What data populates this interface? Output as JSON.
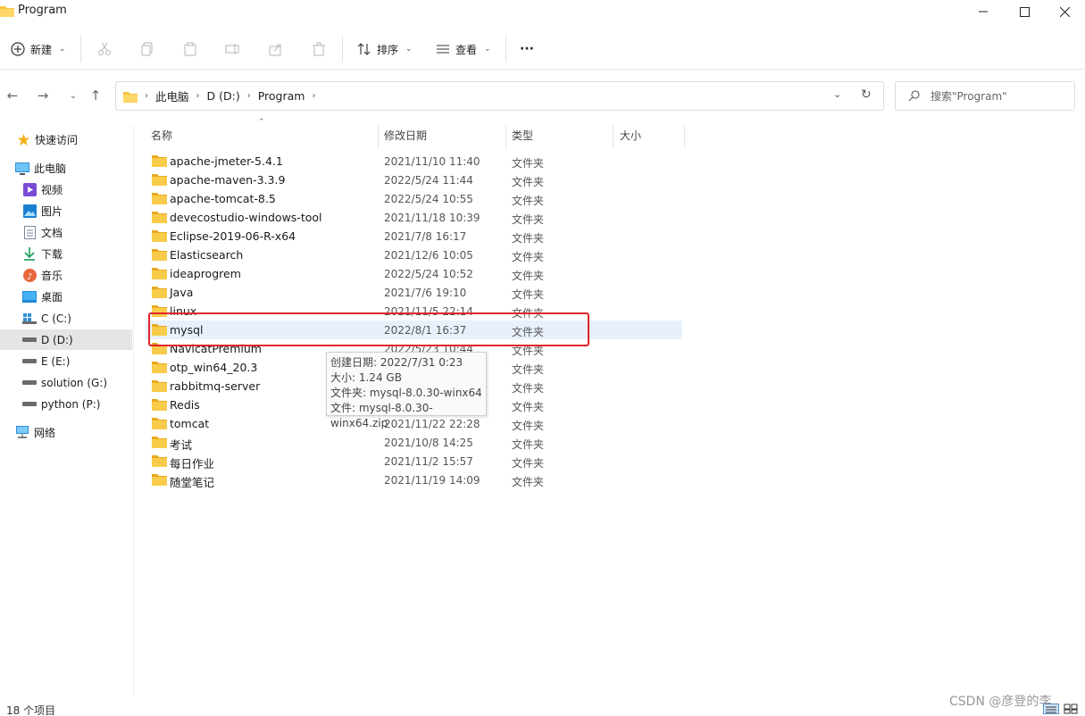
{
  "window": {
    "title": "Program",
    "minimize_label": "",
    "maximize_label": "",
    "close_label": ""
  },
  "toolbar": {
    "new_label": "新建",
    "sort_label": "排序",
    "view_label": "查看",
    "more_label": "···"
  },
  "address": {
    "crumbs": [
      "此电脑",
      "D (D:)",
      "Program"
    ]
  },
  "search": {
    "placeholder": "搜索\"Program\""
  },
  "sidebar": {
    "items": [
      {
        "label": "快速访问",
        "icon": "star-icon"
      },
      {
        "label": "此电脑",
        "icon": "computer-icon"
      },
      {
        "label": "视频",
        "icon": "video-icon"
      },
      {
        "label": "图片",
        "icon": "picture-icon"
      },
      {
        "label": "文档",
        "icon": "document-icon"
      },
      {
        "label": "下载",
        "icon": "download-icon"
      },
      {
        "label": "音乐",
        "icon": "music-icon"
      },
      {
        "label": "桌面",
        "icon": "desktop-icon"
      },
      {
        "label": "C (C:)",
        "icon": "drive-icon"
      },
      {
        "label": "D (D:)",
        "icon": "drive-icon",
        "selected": true
      },
      {
        "label": "E (E:)",
        "icon": "drive-icon"
      },
      {
        "label": "solution (G:)",
        "icon": "drive-icon"
      },
      {
        "label": "python (P:)",
        "icon": "drive-icon"
      },
      {
        "label": "网络",
        "icon": "network-icon"
      }
    ]
  },
  "columns": {
    "name": "名称",
    "date": "修改日期",
    "type": "类型",
    "size": "大小"
  },
  "files": [
    {
      "name": "apache-jmeter-5.4.1",
      "date": "2021/11/10 11:40",
      "type": "文件夹"
    },
    {
      "name": "apache-maven-3.3.9",
      "date": "2022/5/24 11:44",
      "type": "文件夹"
    },
    {
      "name": "apache-tomcat-8.5",
      "date": "2022/5/24 10:55",
      "type": "文件夹"
    },
    {
      "name": "devecostudio-windows-tool",
      "date": "2021/11/18 10:39",
      "type": "文件夹"
    },
    {
      "name": "Eclipse-2019-06-R-x64",
      "date": "2021/7/8 16:17",
      "type": "文件夹"
    },
    {
      "name": "Elasticsearch",
      "date": "2021/12/6 10:05",
      "type": "文件夹"
    },
    {
      "name": "ideaprogrem",
      "date": "2022/5/24 10:52",
      "type": "文件夹"
    },
    {
      "name": "Java",
      "date": "2021/7/6 19:10",
      "type": "文件夹"
    },
    {
      "name": "linux",
      "date": "2021/11/5 22:14",
      "type": "文件夹"
    },
    {
      "name": "mysql",
      "date": "2022/8/1 16:37",
      "type": "文件夹",
      "selected": true
    },
    {
      "name": "NavicatPremium",
      "date": "2022/5/23 10:44",
      "type": "文件夹"
    },
    {
      "name": "otp_win64_20.3",
      "date": "",
      "type": "文件夹"
    },
    {
      "name": "rabbitmq-server",
      "date": "",
      "type": "文件夹"
    },
    {
      "name": "Redis",
      "date": "",
      "type": "文件夹"
    },
    {
      "name": "tomcat",
      "date": "2021/11/22 22:28",
      "type": "文件夹"
    },
    {
      "name": "考试",
      "date": "2021/10/8 14:25",
      "type": "文件夹"
    },
    {
      "name": "每日作业",
      "date": "2021/11/2 15:57",
      "type": "文件夹"
    },
    {
      "name": "随堂笔记",
      "date": "2021/11/19 14:09",
      "type": "文件夹"
    }
  ],
  "tooltip": {
    "lines": [
      "创建日期: 2022/7/31 0:23",
      "大小: 1.24 GB",
      "文件夹: mysql-8.0.30-winx64",
      "文件: mysql-8.0.30-winx64.zip"
    ]
  },
  "status": {
    "count": "18 个项目"
  },
  "watermark": "CSDN @彦登的李",
  "colors": {
    "folder": "#f6c342",
    "highlight": "#e0262b",
    "selected_row": "#e8f1fb"
  }
}
